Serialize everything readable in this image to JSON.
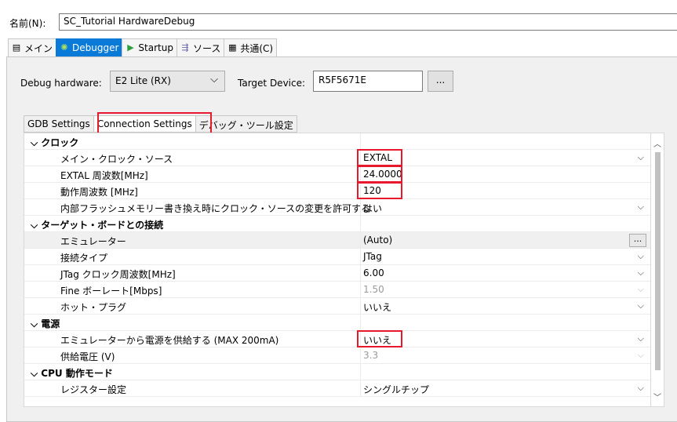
{
  "name_field": {
    "label": "名前(N):",
    "value": "SC_Tutorial HardwareDebug"
  },
  "top_tabs": [
    {
      "label": "メイン",
      "icon": "document-icon"
    },
    {
      "label": "Debugger",
      "icon": "bug-icon"
    },
    {
      "label": "Startup",
      "icon": "play-icon"
    },
    {
      "label": "ソース",
      "icon": "source-icon"
    },
    {
      "label": "共通(C)",
      "icon": "common-icon"
    }
  ],
  "debug_hardware": {
    "label": "Debug hardware:",
    "value": "E2 Lite (RX)"
  },
  "target_device": {
    "label": "Target Device:",
    "value": "R5F5671E",
    "button": "..."
  },
  "sub_tabs": [
    "GDB Settings",
    "Connection Settings",
    "デバッグ・ツール設定"
  ],
  "properties": {
    "cat_clock": "クロック",
    "main_clock_source": {
      "label": "メイン・クロック・ソース",
      "value": "EXTAL"
    },
    "extal_freq": {
      "label": "EXTAL 周波数[MHz]",
      "value": "24.0000"
    },
    "op_freq": {
      "label": "動作周波数 [MHz]",
      "value": "120"
    },
    "flash_clock_change": {
      "label": "内部フラッシュメモリー書き換え時にクロック・ソースの変更を許可する",
      "value": "はい"
    },
    "cat_target": "ターゲット・ボードとの接続",
    "emulator": {
      "label": "エミュレーター",
      "value": "(Auto)",
      "button": "..."
    },
    "connection_type": {
      "label": "接続タイプ",
      "value": "JTag"
    },
    "jtag_freq": {
      "label": "JTag クロック周波数[MHz]",
      "value": "6.00"
    },
    "fine_baud": {
      "label": "Fine ボーレート[Mbps]",
      "value": "1.50"
    },
    "hot_plug": {
      "label": "ホット・プラグ",
      "value": "いいえ"
    },
    "cat_power": "電源",
    "supply_power": {
      "label": "エミュレーターから電源を供給する (MAX 200mA)",
      "value": "いいえ"
    },
    "supply_voltage": {
      "label": "供給電圧 (V)",
      "value": "3.3"
    },
    "cat_cpu": "CPU 動作モード",
    "register_setting": {
      "label": "レジスター設定",
      "value": "シングルチップ"
    }
  },
  "colors": {
    "accent": "#0a7ad8",
    "highlight": "#e8192c"
  }
}
